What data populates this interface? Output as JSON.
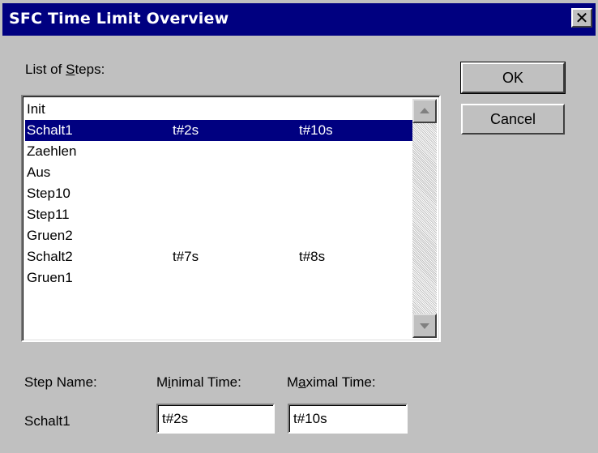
{
  "window": {
    "title": "SFC Time Limit Overview",
    "close_glyph": "✕"
  },
  "list": {
    "label_pre": "List of ",
    "label_accel": "S",
    "label_post": "teps:",
    "rows": [
      {
        "name": "Init",
        "min": "",
        "max": ""
      },
      {
        "name": "Schalt1",
        "min": "t#2s",
        "max": "t#10s",
        "selected": true
      },
      {
        "name": "Zaehlen",
        "min": "",
        "max": ""
      },
      {
        "name": "Aus",
        "min": "",
        "max": ""
      },
      {
        "name": "Step10",
        "min": "",
        "max": ""
      },
      {
        "name": "Step11",
        "min": "",
        "max": ""
      },
      {
        "name": "Gruen2",
        "min": "",
        "max": ""
      },
      {
        "name": "Schalt2",
        "min": "t#7s",
        "max": "t#8s"
      },
      {
        "name": "Gruen1",
        "min": "",
        "max": ""
      }
    ]
  },
  "buttons": {
    "ok": "OK",
    "cancel": "Cancel"
  },
  "fields": {
    "step_name_label": "Step Name:",
    "step_name_value": "Schalt1",
    "min_label_pre": "M",
    "min_label_accel": "i",
    "min_label_post": "nimal Time:",
    "min_value": "t#2s",
    "max_label_pre": "M",
    "max_label_accel": "a",
    "max_label_post": "ximal Time:",
    "max_value": "t#10s"
  },
  "colors": {
    "titlebar": "#000080",
    "selection": "#000080",
    "face": "#c0c0c0"
  }
}
